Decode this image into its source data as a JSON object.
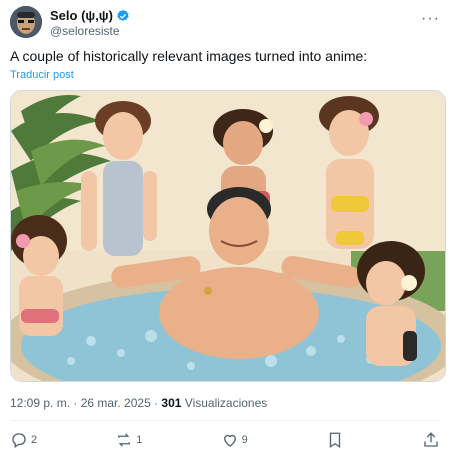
{
  "author": {
    "display_name": "Selo (ψ,ψ)",
    "handle": "@seloresiste"
  },
  "tweet": {
    "text": "A couple of historically relevant images turned into anime:",
    "translate_label": "Traducir post"
  },
  "meta": {
    "time_date": "12:09 p. m. · 26 mar. 2025 · ",
    "views_count": "301",
    "views_label": " Visualizaciones"
  },
  "actions": {
    "replies": "2",
    "reposts": "1",
    "likes": "9",
    "bookmark_icon": "bookmark-icon",
    "share_icon": "share-icon"
  },
  "colors": {
    "accent": "#1d9bf0",
    "text_primary": "#0f1419",
    "text_secondary": "#536471"
  }
}
